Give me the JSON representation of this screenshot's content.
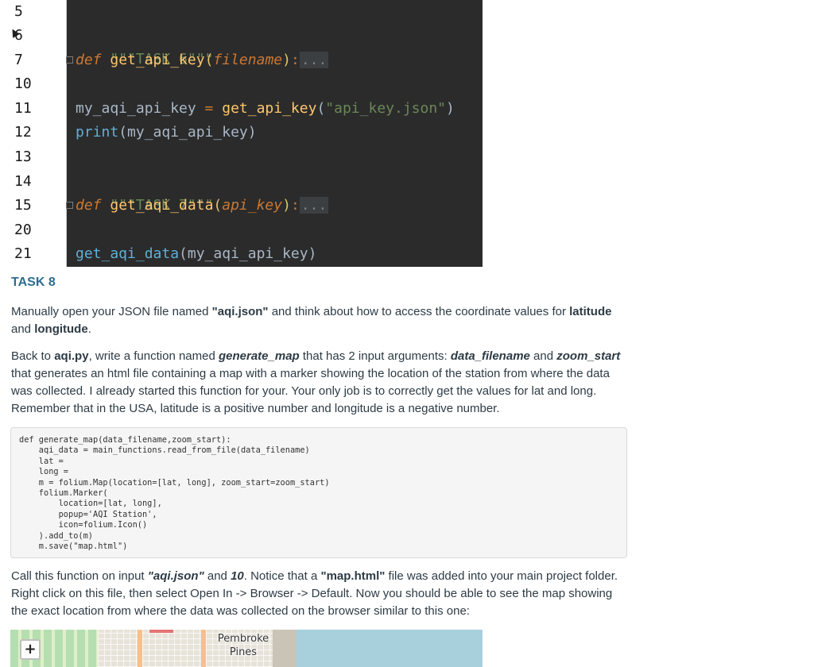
{
  "editor": {
    "line_numbers": [
      "5",
      "6",
      "7",
      "10",
      "11",
      "12",
      "13",
      "14",
      "15",
      "20",
      "21"
    ],
    "task6_docstring": "\"\"\"TASK 6\"\"\"",
    "def_kw": "def",
    "func1_name": "get_api_key",
    "func1_param": "filename",
    "fold_dots": "...",
    "line11_var": "my_aqi_api_key",
    "line11_eq": " = ",
    "line11_call": "get_api_key",
    "line11_arg": "\"api_key.json\"",
    "line12_print": "print",
    "line12_arg": "(my_aqi_api_key)",
    "task7_docstring": "\"\"\"TASK 7\"\"\"",
    "func2_name": "get_aqi_data",
    "func2_param": "api_key",
    "line21_call": "get_aqi_data",
    "line21_arg": "(my_aqi_api_key)"
  },
  "task8": {
    "heading": "TASK 8",
    "p1_a": "Manually open your JSON file named ",
    "p1_file": "\"aqi.json\"",
    "p1_b": " and think about how to access the coordinate values for ",
    "p1_lat": "latitude",
    "p1_c": " and ",
    "p1_long": "longitude",
    "p1_d": ".",
    "p2_a": "Back to ",
    "p2_file": "aqi.py",
    "p2_b": ", write a function named ",
    "p2_func": "generate_map",
    "p2_c": " that has 2 input arguments: ",
    "p2_arg1": "data_filename",
    "p2_d": " and ",
    "p2_arg2": "zoom_start",
    "p2_e": " that generates an html file containing a map with a marker showing the location of the station from where the data was collected. I already started this function for your. Your only job is to correctly get the values for lat and long. Remember that in the USA, latitude is a positive number and longitude is a negative number.",
    "code_block": "def generate_map(data_filename,zoom_start):\n    aqi_data = main_functions.read_from_file(data_filename)\n    lat = \n    long = \n    m = folium.Map(location=[lat, long], zoom_start=zoom_start)\n    folium.Marker(\n        location=[lat, long],\n        popup='AQI Station',\n        icon=folium.Icon()\n    ).add_to(m)\n    m.save(\"map.html\")",
    "p3_a": "Call this function on input ",
    "p3_arg1": "\"aqi.json\"",
    "p3_b": " and ",
    "p3_arg2": "10",
    "p3_c": ". Notice that a ",
    "p3_file": "\"map.html\"",
    "p3_d": " file was added into your main project folder. Right click on this file, then select Open In -> Browser -> Default. Now you should be able to see the map showing the exact location from where the data was collected on the browser similar to this one:"
  },
  "map": {
    "zoom_in_label": "+",
    "place_line1": "Pembroke",
    "place_line2": "Pines"
  }
}
